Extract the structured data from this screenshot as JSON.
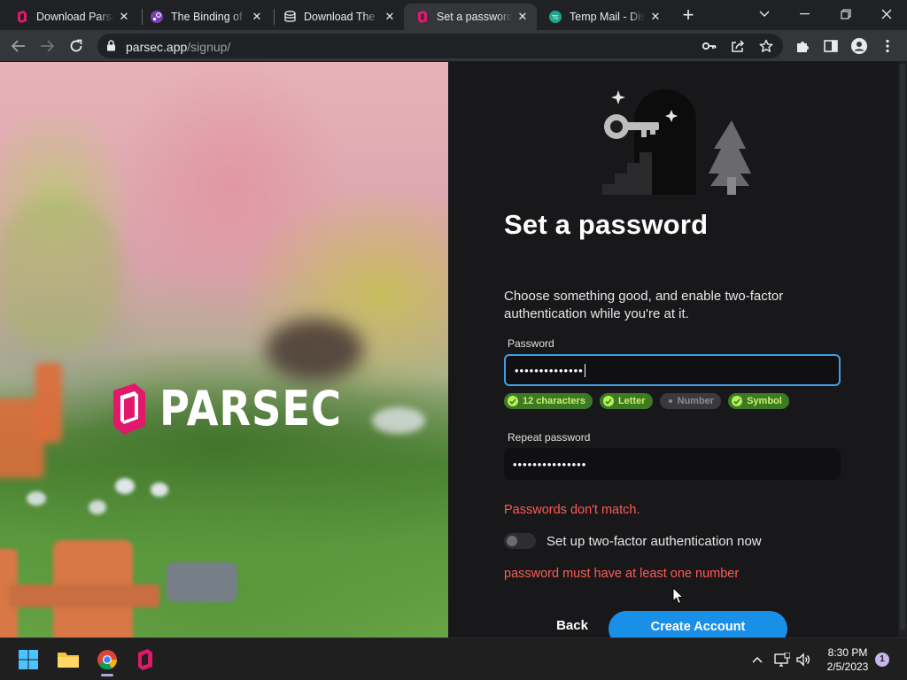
{
  "browser": {
    "tabs": [
      {
        "title": "Download Parsec",
        "icon": "parsec-favicon-icon"
      },
      {
        "title": "The Binding of Isaac",
        "icon": "steam-favicon-icon"
      },
      {
        "title": "Download The Binding of Isaac",
        "icon": "database-favicon-icon"
      },
      {
        "title": "Set a password",
        "icon": "parsec-favicon-icon",
        "active": true
      },
      {
        "title": "Temp Mail - Disposable",
        "icon": "tempmail-favicon-icon"
      }
    ],
    "url_host": "parsec.app",
    "url_path": "/signup/"
  },
  "hero": {
    "brand": "PARSEC"
  },
  "form": {
    "heading": "Set a password",
    "subtitle": "Choose something good, and enable two-factor authentication while you're at it.",
    "password_label": "Password",
    "password_value": "••••••••••••••",
    "repeat_label": "Repeat password",
    "repeat_value": "•••••••••••••••",
    "requirements": [
      {
        "label": "12 characters",
        "met": true
      },
      {
        "label": "Letter",
        "met": true
      },
      {
        "label": "Number",
        "met": false
      },
      {
        "label": "Symbol",
        "met": true
      }
    ],
    "mismatch_error": "Passwords don't match.",
    "twofa_label": "Set up two-factor authentication now",
    "twofa_enabled": false,
    "number_error": "password must have at least one number",
    "back_label": "Back",
    "create_label": "Create Account"
  },
  "taskbar": {
    "time": "8:30 PM",
    "date": "2/5/2023",
    "notifications": "1"
  },
  "colors": {
    "accent": "#1a8fe8",
    "error": "#ff5a55",
    "success_badge": "#3d7a25"
  }
}
